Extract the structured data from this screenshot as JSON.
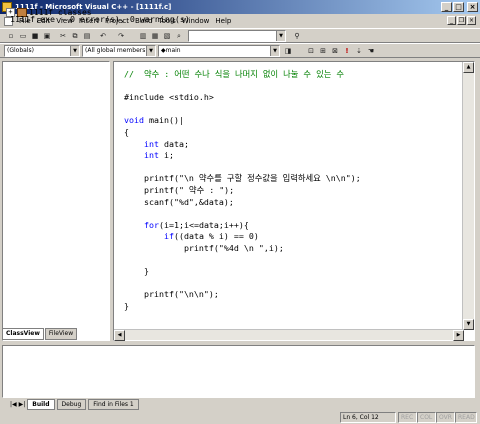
{
  "window": {
    "title": "1111f - Microsoft Visual C++ - [1111f.c]",
    "buttons": {
      "minimize": "_",
      "maximize": "□",
      "close": "×"
    }
  },
  "menu": {
    "items": [
      "File",
      "Edit",
      "View",
      "Insert",
      "Project",
      "Build",
      "Tools",
      "Window",
      "Help"
    ],
    "mdi_buttons": {
      "minimize": "_",
      "restore": "❐",
      "close": "×"
    }
  },
  "toolbar": {
    "find_combo_value": "",
    "globals_combo": "(Globals)",
    "members_combo": "(All global members",
    "function_combo": "◆main"
  },
  "workspace": {
    "tree_root": "1111f classes",
    "expand_symbol": "+",
    "tabs": [
      "ClassView",
      "FileView"
    ]
  },
  "editor": {
    "code_lines": [
      {
        "parts": [
          {
            "t": "//  약수 : 어떤 수나 식을 나머지 없이 나눌 수 있는 수",
            "c": "cm"
          }
        ]
      },
      {
        "parts": [
          {
            "t": ""
          }
        ]
      },
      {
        "parts": [
          {
            "t": "#include <stdio.h>"
          }
        ]
      },
      {
        "parts": [
          {
            "t": ""
          }
        ]
      },
      {
        "parts": [
          {
            "t": "void",
            "c": "kw"
          },
          {
            "t": " main()|"
          }
        ]
      },
      {
        "parts": [
          {
            "t": "{"
          }
        ]
      },
      {
        "parts": [
          {
            "t": "    "
          },
          {
            "t": "int",
            "c": "kw"
          },
          {
            "t": " data;"
          }
        ]
      },
      {
        "parts": [
          {
            "t": "    "
          },
          {
            "t": "int",
            "c": "kw"
          },
          {
            "t": " i;"
          }
        ]
      },
      {
        "parts": [
          {
            "t": ""
          }
        ]
      },
      {
        "parts": [
          {
            "t": "    printf(\"\\n 약수를 구할 정수값을 입력하세요 \\n\\n\");"
          }
        ]
      },
      {
        "parts": [
          {
            "t": "    printf(\" 약수 : \");"
          }
        ]
      },
      {
        "parts": [
          {
            "t": "    scanf(\"%d\",&data);"
          }
        ]
      },
      {
        "parts": [
          {
            "t": ""
          }
        ]
      },
      {
        "parts": [
          {
            "t": "    "
          },
          {
            "t": "for",
            "c": "kw"
          },
          {
            "t": "(i=1;i<=data;i++){"
          }
        ]
      },
      {
        "parts": [
          {
            "t": "        "
          },
          {
            "t": "if",
            "c": "kw"
          },
          {
            "t": "((data % i) == 0)"
          }
        ]
      },
      {
        "parts": [
          {
            "t": "            printf(\"%4d \\n \",i);"
          }
        ]
      },
      {
        "parts": [
          {
            "t": ""
          }
        ]
      },
      {
        "parts": [
          {
            "t": "    }"
          }
        ]
      },
      {
        "parts": [
          {
            "t": ""
          }
        ]
      },
      {
        "parts": [
          {
            "t": "    printf(\"\\n\\n\");"
          }
        ]
      },
      {
        "parts": [
          {
            "t": "}"
          }
        ]
      }
    ]
  },
  "output": {
    "text": "1111f.exe - 0 error(s), 0 warning(s)",
    "tabs": [
      "Build",
      "Debug",
      "Find in Files 1"
    ]
  },
  "status": {
    "position": "Ln 6, Col 12",
    "indicators": [
      "REC",
      "COL",
      "OVR",
      "READ"
    ]
  },
  "colors": {
    "keyword": "#0000ff",
    "comment": "#008000",
    "titlebar_start": "#0a246a",
    "titlebar_end": "#a6caf0"
  }
}
